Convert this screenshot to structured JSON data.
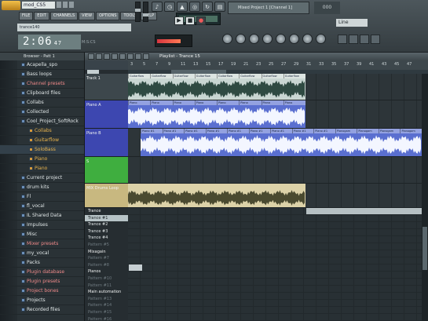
{
  "app": {
    "song_title": "mod_CS5",
    "hint_text": "trance140",
    "time": "2:06",
    "time_sub": "47",
    "time_unit": "M:S:CS"
  },
  "menu": [
    "FILE",
    "EDIT",
    "CHANNELS",
    "VIEW",
    "OPTIONS",
    "TOOLS",
    "HELP"
  ],
  "song_lcd": "Mixed Project 1 [Channel 1]",
  "song_pos": "000",
  "pattern_box": "Line",
  "browser": {
    "title": "Browser - Patt 1",
    "items": [
      {
        "label": "Acapella_spo",
        "type": "folder"
      },
      {
        "label": "Bass loops",
        "type": "folder"
      },
      {
        "label": "Channel presets",
        "type": "folder",
        "hl": true
      },
      {
        "label": "Clipboard files",
        "type": "folder"
      },
      {
        "label": "Collabs",
        "type": "folder"
      },
      {
        "label": "Collected",
        "type": "folder"
      },
      {
        "label": "Cool_Project_SoftRock",
        "type": "folder"
      },
      {
        "label": "Collabs",
        "type": "folder",
        "child": true
      },
      {
        "label": "Guitarflow",
        "type": "file",
        "child": true
      },
      {
        "label": "SoloBass",
        "type": "file",
        "child": true,
        "sel": true
      },
      {
        "label": "Piano",
        "type": "file",
        "child": true
      },
      {
        "label": "Piano",
        "type": "file",
        "child": true
      },
      {
        "label": "Current project",
        "type": "folder"
      },
      {
        "label": "drum kits",
        "type": "folder"
      },
      {
        "label": "Fl",
        "type": "folder"
      },
      {
        "label": "fl_vocal",
        "type": "folder"
      },
      {
        "label": "IL Shared Data",
        "type": "folder"
      },
      {
        "label": "Impulses",
        "type": "folder"
      },
      {
        "label": "Misc",
        "type": "folder"
      },
      {
        "label": "Mixer presets",
        "type": "folder",
        "hl": true
      },
      {
        "label": "my_vocal",
        "type": "folder"
      },
      {
        "label": "Packs",
        "type": "folder"
      },
      {
        "label": "Plugin database",
        "type": "folder",
        "hl": true
      },
      {
        "label": "Plugin presets",
        "type": "folder",
        "hl": true
      },
      {
        "label": "Project bones",
        "type": "folder",
        "hl": true
      },
      {
        "label": "Projects",
        "type": "folder"
      },
      {
        "label": "Recorded files",
        "type": "folder"
      }
    ]
  },
  "playlist": {
    "title": "Playlist - Trance 15",
    "ruler_ticks": [
      "3",
      "5",
      "7",
      "9",
      "11",
      "13",
      "15",
      "17",
      "19",
      "21",
      "23",
      "25",
      "27",
      "29",
      "31",
      "33",
      "35",
      "37",
      "39",
      "41",
      "43",
      "45",
      "47"
    ],
    "tracks": [
      {
        "name": "Track 1",
        "color": "#3d474c",
        "clip_color": "#c9d6d2",
        "clip_labels": [
          "Guitarflow",
          "Guitarflow",
          "Guitarflow",
          "Guitarflow",
          "Guitarflow",
          "Guitarflow",
          "Guitarflow",
          "Guitarflow"
        ]
      },
      {
        "name": "Piano A",
        "color": "#3d47b0",
        "clip_color": "#5a6fd0",
        "clip_labels": [
          "Piano",
          "Piano",
          "Piano",
          "Piano",
          "Piano",
          "Piano",
          "Piano",
          "Piano"
        ]
      },
      {
        "name": "Piano B",
        "color": "#3d47b0",
        "clip_color": "#5a6fd0",
        "clip_labels": [
          "Piano #1",
          "Piano #1",
          "Piano #1",
          "Piano #1",
          "Piano #1",
          "Piano #1",
          "Piano #1",
          "Piano #1",
          "Piano #1",
          "Pianogam",
          "Pianogam",
          "Pianogam",
          "Pianogam"
        ]
      },
      {
        "name": "S",
        "color": "#3fae3f",
        "clip_color": "#2d3539",
        "clip_labels": []
      },
      {
        "name": "MIX Drums Loop",
        "color": "#c8b880",
        "clip_color": "#dcd2a8",
        "clip_labels": []
      }
    ],
    "patterns": [
      {
        "label": "Trance",
        "kind": "group"
      },
      {
        "label": "Trance #1",
        "kind": "sel"
      },
      {
        "label": "Trance #2",
        "kind": "item"
      },
      {
        "label": "Trance #3",
        "kind": "item"
      },
      {
        "label": "Trance #4",
        "kind": "item"
      },
      {
        "label": "Pattern #5",
        "kind": "dim"
      },
      {
        "label": "Mixagain",
        "kind": "group"
      },
      {
        "label": "Pattern #7",
        "kind": "dim"
      },
      {
        "label": "Pattern #8",
        "kind": "dim"
      },
      {
        "label": "Pianos",
        "kind": "group"
      },
      {
        "label": "Pattern #10",
        "kind": "dim"
      },
      {
        "label": "Pattern #11",
        "kind": "dim"
      },
      {
        "label": "Main automation",
        "kind": "group"
      },
      {
        "label": "Pattern #13",
        "kind": "dim"
      },
      {
        "label": "Pattern #14",
        "kind": "dim"
      },
      {
        "label": "Pattern #15",
        "kind": "dim"
      },
      {
        "label": "Pattern #16",
        "kind": "dim"
      }
    ]
  }
}
